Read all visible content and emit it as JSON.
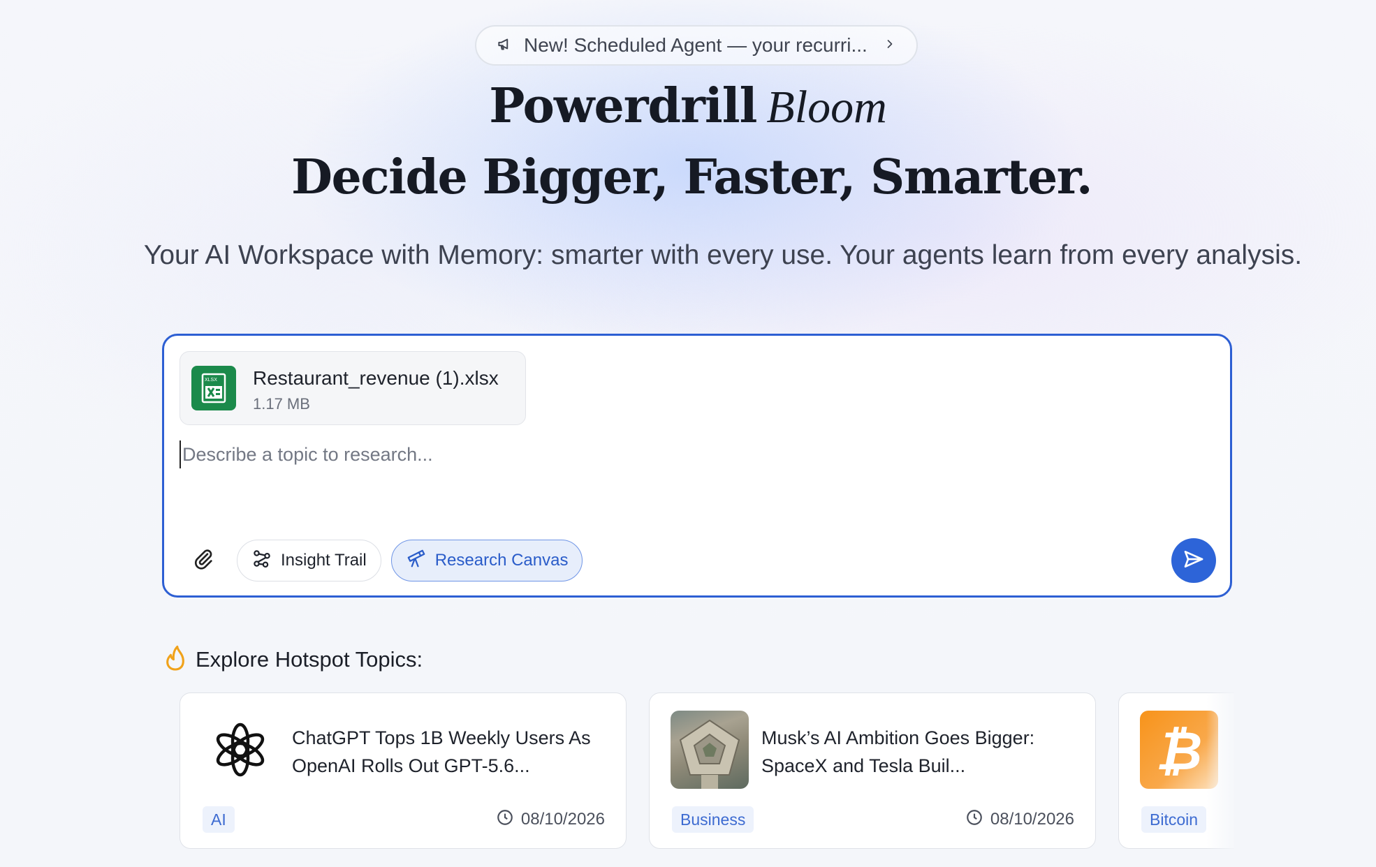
{
  "announcement": {
    "text": "New! Scheduled Agent — your recurri...",
    "icon": "megaphone-icon",
    "arrow_icon": "chevron-right-icon"
  },
  "hero": {
    "brand_name": "Powerdrill",
    "brand_suffix": "Bloom",
    "headline": "Decide Bigger, Faster, Smarter.",
    "subtitle": "Your AI Workspace with Memory: smarter with every use. Your agents learn from every analysis."
  },
  "composer": {
    "attachment": {
      "file_name": "Restaurant_revenue (1).xlsx",
      "file_size": "1.17 MB",
      "icon": "xlsx-file-icon",
      "badge_text": "XLSX"
    },
    "placeholder": "Describe a topic to research...",
    "value": "",
    "insight_trail_label": "Insight Trail",
    "research_canvas_label": "Research Canvas",
    "accent_color": "#2d5fd3"
  },
  "hotspots": {
    "heading": "Explore Hotspot Topics:",
    "cards": [
      {
        "title": "ChatGPT Tops 1B Weekly Users As OpenAI Rolls Out GPT-5.6...",
        "tag": "AI",
        "date": "08/10/2026",
        "thumb": "openai-logo"
      },
      {
        "title": "Musk’s AI Ambition Goes Bigger: SpaceX and Tesla Buil...",
        "tag": "Business",
        "date": "08/10/2026",
        "thumb": "pentagon-photo"
      },
      {
        "title": "",
        "tag": "Bitcoin",
        "date": "",
        "thumb": "bitcoin-logo"
      }
    ]
  }
}
